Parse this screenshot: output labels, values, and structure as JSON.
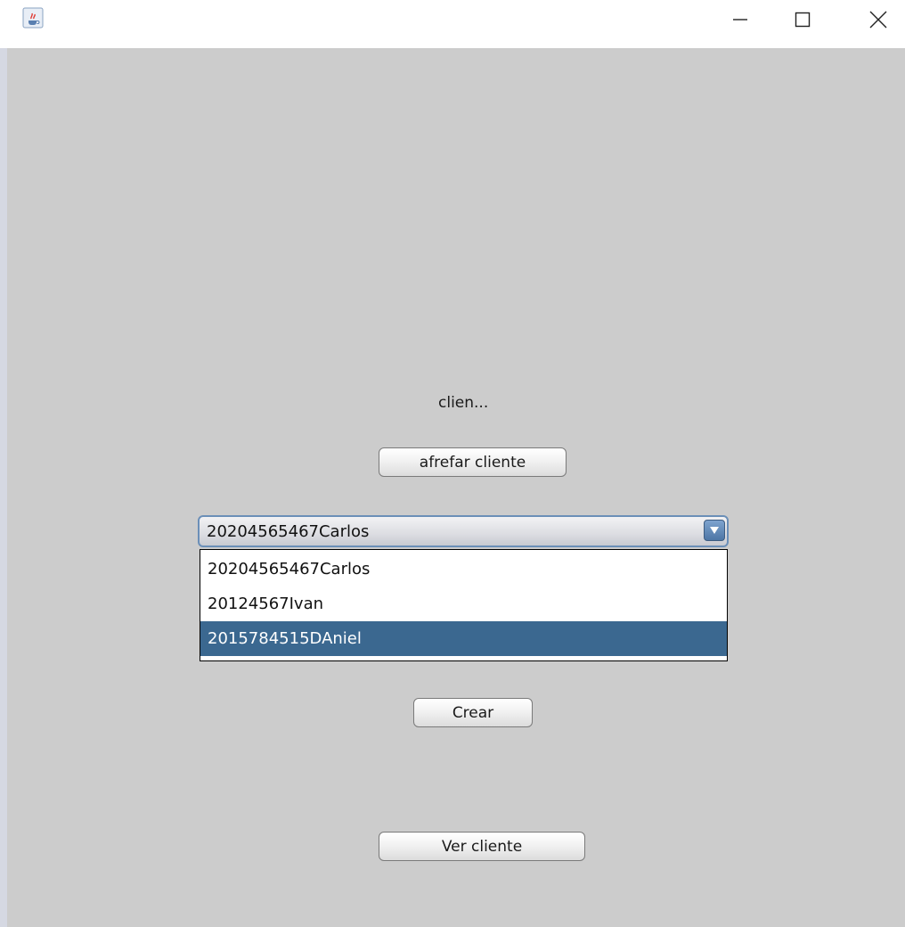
{
  "window": {
    "controls": {
      "minimize_glyph": "—",
      "maximize_glyph": "☐",
      "close_glyph": "✕"
    },
    "icon": "java-cup-icon"
  },
  "main": {
    "label": "clien...",
    "add_button": "afrefar cliente",
    "combo": {
      "selected": "20204565467Carlos",
      "options": [
        "20204565467Carlos",
        "20124567Ivan",
        "2015784515DAniel"
      ],
      "highlighted_index": 2
    },
    "create_button": "Crear",
    "view_button": "Ver cliente"
  },
  "colors": {
    "background": "#cccccc",
    "highlight": "#3b6890",
    "combo_border": "#6b8fb8"
  }
}
